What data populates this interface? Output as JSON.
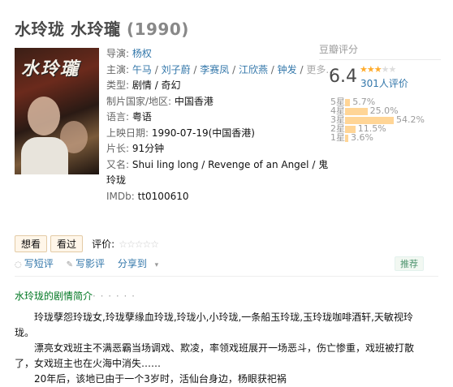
{
  "movie": {
    "title": "水玲珑 水玲瓏",
    "year": "(1990)",
    "poster_title": "水玲瓏"
  },
  "info": {
    "director_label": "导演:",
    "director": "杨权",
    "cast_label": "主演:",
    "cast": [
      "午马",
      "刘子蔚",
      "李赛凤",
      "江欣燕",
      "钟发"
    ],
    "cast_more": "更多...",
    "genre_label": "类型:",
    "genre": "剧情 / 奇幻",
    "country_label": "制片国家/地区:",
    "country": "中国香港",
    "language_label": "语言:",
    "language": "粤语",
    "release_label": "上映日期:",
    "release": "1990-07-19(中国香港)",
    "runtime_label": "片长:",
    "runtime": "91分钟",
    "aka_label": "又名:",
    "aka_line1": "Shui ling long / Revenge of an Angel / 鬼",
    "aka_line2": "玲珑",
    "imdb_label": "IMDb:",
    "imdb": "tt0100610"
  },
  "rating": {
    "header": "豆瓣评分",
    "score": "6.4",
    "stars_filled": 3,
    "votes": "301人评价",
    "distribution": [
      {
        "label": "5星",
        "percent": "5.7%",
        "value": 5.7
      },
      {
        "label": "4星",
        "percent": "25.0%",
        "value": 25.0
      },
      {
        "label": "3星",
        "percent": "54.2%",
        "value": 54.2
      },
      {
        "label": "2星",
        "percent": "11.5%",
        "value": 11.5
      },
      {
        "label": "1星",
        "percent": "3.6%",
        "value": 3.6
      }
    ]
  },
  "interest": {
    "want_label": "想看",
    "seen_label": "看过",
    "rate_label": "评价:"
  },
  "actions": {
    "write_review": "写短评",
    "write_long_review": "写影评",
    "share": "分享到",
    "recommend": "推荐"
  },
  "synopsis": {
    "title": "水玲珑的剧情简介",
    "dots": "· · · · · ·",
    "p1": "玲珑孽怨玲珑女,玲珑孽缘血玲珑,玲珑小,小玲珑,一条船玉玲珑,玉玲珑咖啡酒轩,天敏视玲珑。",
    "p2": "漂亮女戏班主不满恶霸当场调戏、欺凌，率领戏班展开一场恶斗，伤亡惨重，戏班被打散了，女戏班主也在火海中消失……",
    "p3": "20年后，该地已由于一个3岁时，活仙台身边，杨眼获祀祸"
  },
  "colors": {
    "link": "#3377aa",
    "star": "#ffac2d",
    "bar": "#ffd596",
    "section_title": "#007722"
  }
}
